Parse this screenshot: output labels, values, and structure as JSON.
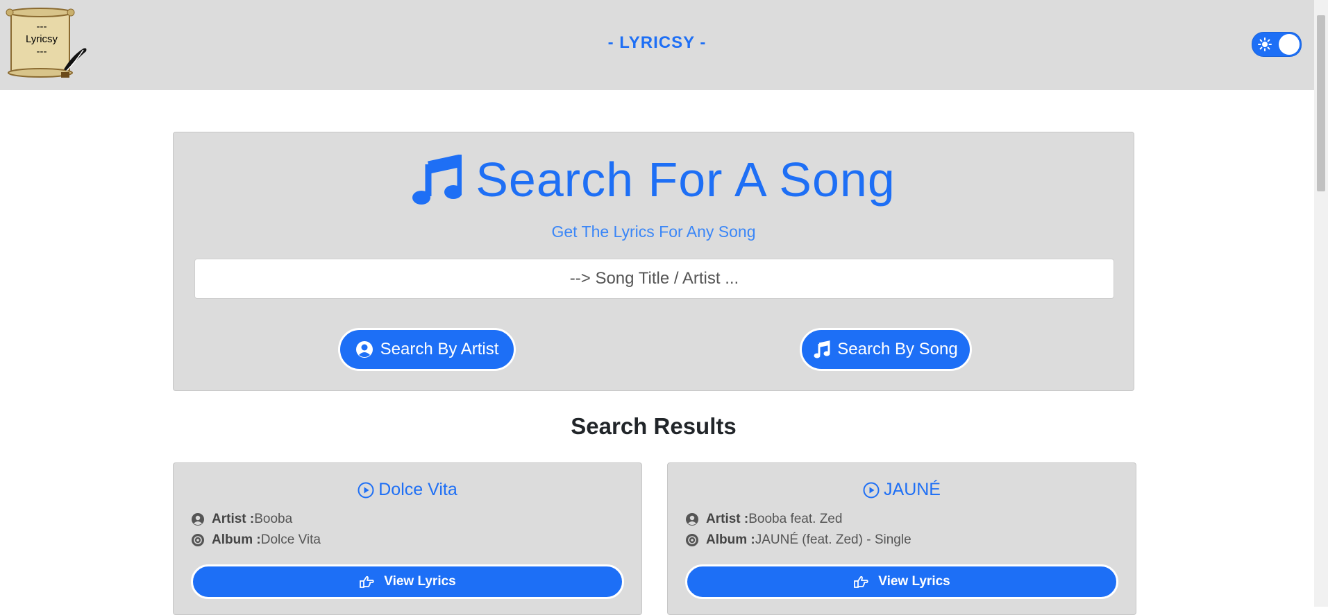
{
  "header": {
    "logo_text": [
      "---",
      "Lyricsy",
      "---"
    ],
    "brand": "- LYRICSY -",
    "theme_toggle": {
      "state": "on",
      "icon": "sun-icon"
    }
  },
  "search": {
    "title": "Search For A Song",
    "subtitle": "Get The Lyrics For Any Song",
    "input_placeholder": "--> Song Title / Artist ...",
    "input_value": "",
    "btn_artist": "Search By Artist",
    "btn_song": "Search By Song"
  },
  "results": {
    "heading": "Search Results",
    "artist_label": "Artist :",
    "album_label": "Album :",
    "view_label": "View Lyrics",
    "items": [
      {
        "title": "Dolce Vita",
        "artist": "Booba",
        "album": "Dolce Vita"
      },
      {
        "title": "JAUNÉ",
        "artist": "Booba feat. Zed",
        "album": "JAUNÉ (feat. Zed) - Single"
      }
    ]
  },
  "colors": {
    "accent": "#1d6ff6",
    "panel": "#dcdcdc",
    "header": "#dcdcdc"
  }
}
